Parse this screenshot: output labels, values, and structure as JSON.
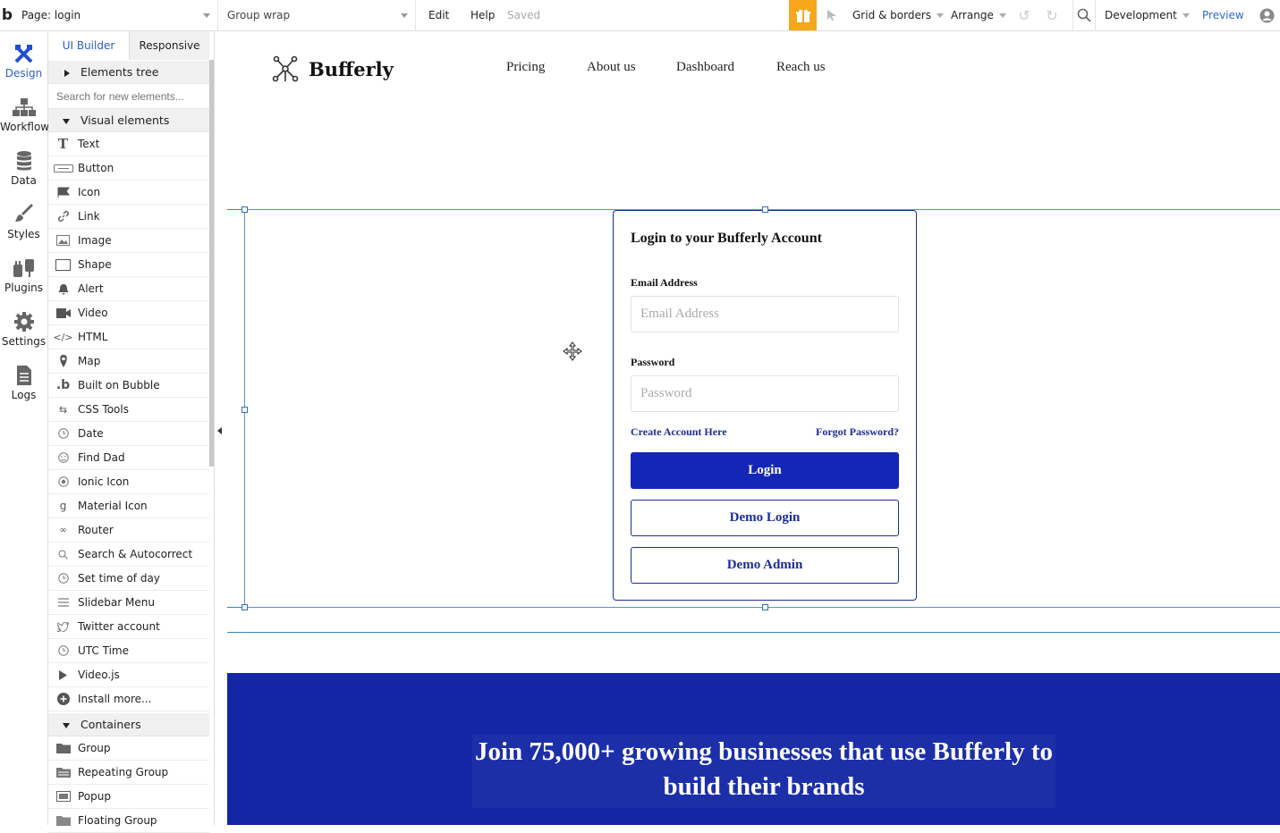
{
  "topbar": {
    "logo": "b",
    "page_label": "Page: login",
    "group_label": "Group wrap",
    "edit": "Edit",
    "help": "Help",
    "saved": "Saved",
    "grid_borders": "Grid & borders",
    "arrange": "Arrange",
    "environment": "Development",
    "preview": "Preview",
    "gift_color": "#f6a71c"
  },
  "leftnav": {
    "items": [
      {
        "label": "Design",
        "icon": "design-icon"
      },
      {
        "label": "Workflow",
        "icon": "workflow-icon"
      },
      {
        "label": "Data",
        "icon": "database-icon"
      },
      {
        "label": "Styles",
        "icon": "brush-icon"
      },
      {
        "label": "Plugins",
        "icon": "plug-icon"
      },
      {
        "label": "Settings",
        "icon": "gear-icon"
      },
      {
        "label": "Logs",
        "icon": "document-icon"
      }
    ]
  },
  "panel": {
    "tabs": [
      "UI Builder",
      "Responsive"
    ],
    "elements_tree": "Elements tree",
    "search_placeholder": "Search for new elements...",
    "visual_elements": "Visual elements",
    "visual": [
      {
        "label": "Text",
        "icon": "text-icon"
      },
      {
        "label": "Button",
        "icon": "button-icon"
      },
      {
        "label": "Icon",
        "icon": "flag-icon"
      },
      {
        "label": "Link",
        "icon": "link-icon"
      },
      {
        "label": "Image",
        "icon": "image-icon"
      },
      {
        "label": "Shape",
        "icon": "shape-icon"
      },
      {
        "label": "Alert",
        "icon": "bell-icon"
      },
      {
        "label": "Video",
        "icon": "video-icon"
      },
      {
        "label": "HTML",
        "icon": "code-icon"
      },
      {
        "label": "Map",
        "icon": "map-pin-icon"
      },
      {
        "label": "Built on Bubble",
        "icon": "bubble-icon"
      },
      {
        "label": "CSS Tools",
        "icon": "css-icon"
      },
      {
        "label": "Date",
        "icon": "clock-icon"
      },
      {
        "label": "Find Dad",
        "icon": "face-icon"
      },
      {
        "label": "Ionic Icon",
        "icon": "ionic-icon"
      },
      {
        "label": "Material Icon",
        "icon": "material-icon"
      },
      {
        "label": "Router",
        "icon": "router-icon"
      },
      {
        "label": "Search & Autocorrect",
        "icon": "search-icon"
      },
      {
        "label": "Set time of day",
        "icon": "clock-icon"
      },
      {
        "label": "Slidebar Menu",
        "icon": "menu-icon"
      },
      {
        "label": "Twitter account",
        "icon": "twitter-icon"
      },
      {
        "label": "UTC Time",
        "icon": "clock-icon"
      },
      {
        "label": "Video.js",
        "icon": "play-icon"
      },
      {
        "label": "Install more...",
        "icon": "plus-circle-icon"
      }
    ],
    "containers_label": "Containers",
    "containers": [
      {
        "label": "Group",
        "icon": "folder-icon"
      },
      {
        "label": "Repeating Group",
        "icon": "repeating-group-icon"
      },
      {
        "label": "Popup",
        "icon": "popup-icon"
      },
      {
        "label": "Floating Group",
        "icon": "folder-icon"
      }
    ]
  },
  "canvas": {
    "brand": "Bufferly",
    "nav": [
      "Pricing",
      "About us",
      "Dashboard",
      "Reach us"
    ],
    "card": {
      "title": "Login to your Bufferly Account",
      "email_label": "Email Address",
      "email_placeholder": "Email Address",
      "password_label": "Password",
      "password_placeholder": "Password",
      "create_account": "Create Account Here",
      "forgot_password": "Forgot Password?",
      "login": "Login",
      "demo_login": "Demo Login",
      "demo_admin": "Demo Admin"
    },
    "footer_headline": "Join 75,000+ growing businesses that use Bufferly to build their brands",
    "colors": {
      "primary": "#1326b8",
      "footer": "#1326a6",
      "selection": "#2f88c0"
    }
  }
}
